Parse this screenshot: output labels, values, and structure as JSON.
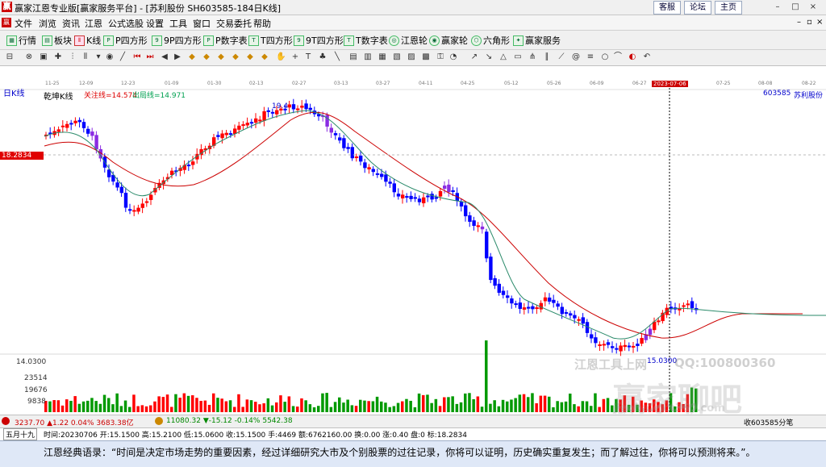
{
  "window": {
    "title": "赢家江恩专业版[赢家服务平台] - [苏利股份  SH603585-184日K线]",
    "buttons": [
      "客服",
      "论坛",
      "主页"
    ],
    "controls": [
      "–",
      "□",
      "×"
    ]
  },
  "menu": [
    "文件",
    "浏览",
    "资讯",
    "江恩",
    "公式选股",
    "设置",
    "工具",
    "窗口",
    "交易委托",
    "帮助"
  ],
  "toolbar": [
    "行情",
    "板块",
    "K线",
    "P四方形",
    "9P四方形",
    "P数字表",
    "T四方形",
    "9T四方形",
    "T数字表",
    "江恩轮",
    "赢家轮",
    "六角形",
    "赢家服务"
  ],
  "date_axis": {
    "labels": [
      "11-25",
      "12-09",
      "12-23",
      "01-09",
      "01-30",
      "02-13",
      "02-27",
      "03-13",
      "03-27",
      "04-11",
      "04-25",
      "05-12",
      "05-26",
      "06-09",
      "06-27",
      "07-25",
      "08-08",
      "08-22"
    ],
    "current": "2023-07-06"
  },
  "chart": {
    "period_label": "日K线",
    "indicator_name": "乾坤K线",
    "focus_line": "关注线=14.574",
    "exit_line": "出局线=14.971",
    "stock_code": "603585",
    "stock_name": "苏利股份",
    "price_flag": "18.2834",
    "high_label": "19.4",
    "low_label": "15.0300",
    "vol_ticks": [
      "14.0300",
      "23514",
      "19676",
      "9838"
    ],
    "watermark_1": "江恩工具上网",
    "watermark_2": "QQ:100800360",
    "watermark_3": "赢家聊吧",
    "watermark_4": "jiaoba.vict360.com",
    "colors": {
      "up": "#ff0000",
      "down": "#0000ff",
      "turn": "#8a2be2",
      "vol_up": "#ff0000",
      "vol_down": "#009900"
    }
  },
  "status": {
    "sh_index": "3237.70",
    "sh_change": "▲1.22 0.04%",
    "sh_amount": "3683.38亿",
    "sz_index": "11080.32",
    "sz_change": "▼-15.12 -0.14%",
    "sz_amount": "5542.38",
    "right": "收603585分笔"
  },
  "info": {
    "tab": "五月十九",
    "text": "时间:20230706 开:15.1500 高:15.2100 低:15.0600 收:15.1500 手:4469 额:6762160.00 换:0.00 涨:0.40 盘:0 标:18.2834"
  },
  "quote": "江恩经典语录：“时间是决定市场走势的重要因素，经过详细研究大市及个别股票的过往记录，你将可以证明，历史确实重复发生；而了解过往，你将可以预测将来。”。"
}
